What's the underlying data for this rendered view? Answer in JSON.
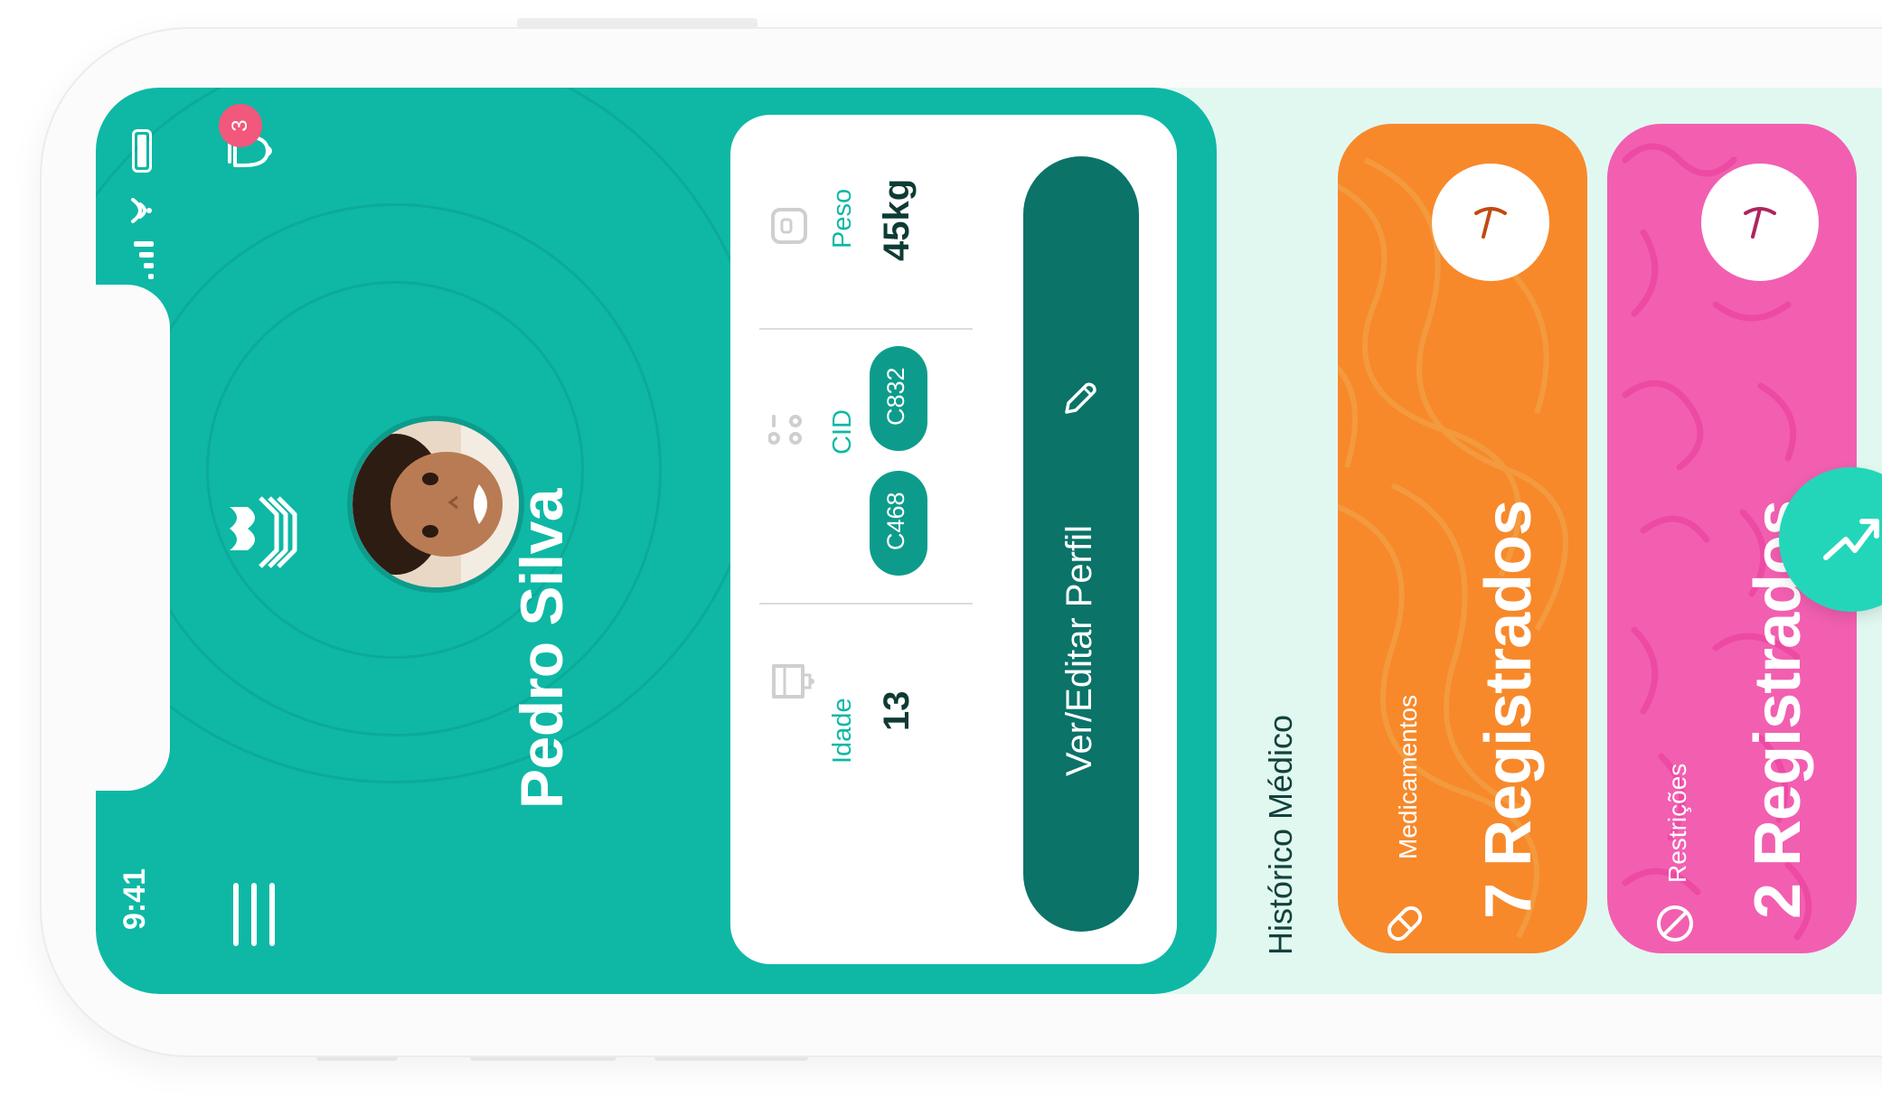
{
  "status_bar": {
    "time": "9:41"
  },
  "notifications": {
    "count": "3"
  },
  "profile": {
    "name": "Pedro Silva",
    "age_label": "Idade",
    "age_value": "13",
    "cid_label": "CID",
    "cid_codes": [
      "C468",
      "C832"
    ],
    "weight_label": "Peso",
    "weight_value": "45kg",
    "edit_button_label": "Ver/Editar Perfil"
  },
  "history": {
    "title": "Histórico Médico",
    "cards": [
      {
        "category": "Medicamentos",
        "count": "7 Registrados",
        "color": "#f7892b"
      },
      {
        "category": "Restrições",
        "count": "2 Registrados",
        "color": "#f25fb0"
      }
    ]
  },
  "colors": {
    "primary": "#0eb8a5",
    "primary_dark": "#0b7368",
    "badge": "#f2587b",
    "background": "#e1f8f1",
    "fab": "#24d6b9"
  }
}
